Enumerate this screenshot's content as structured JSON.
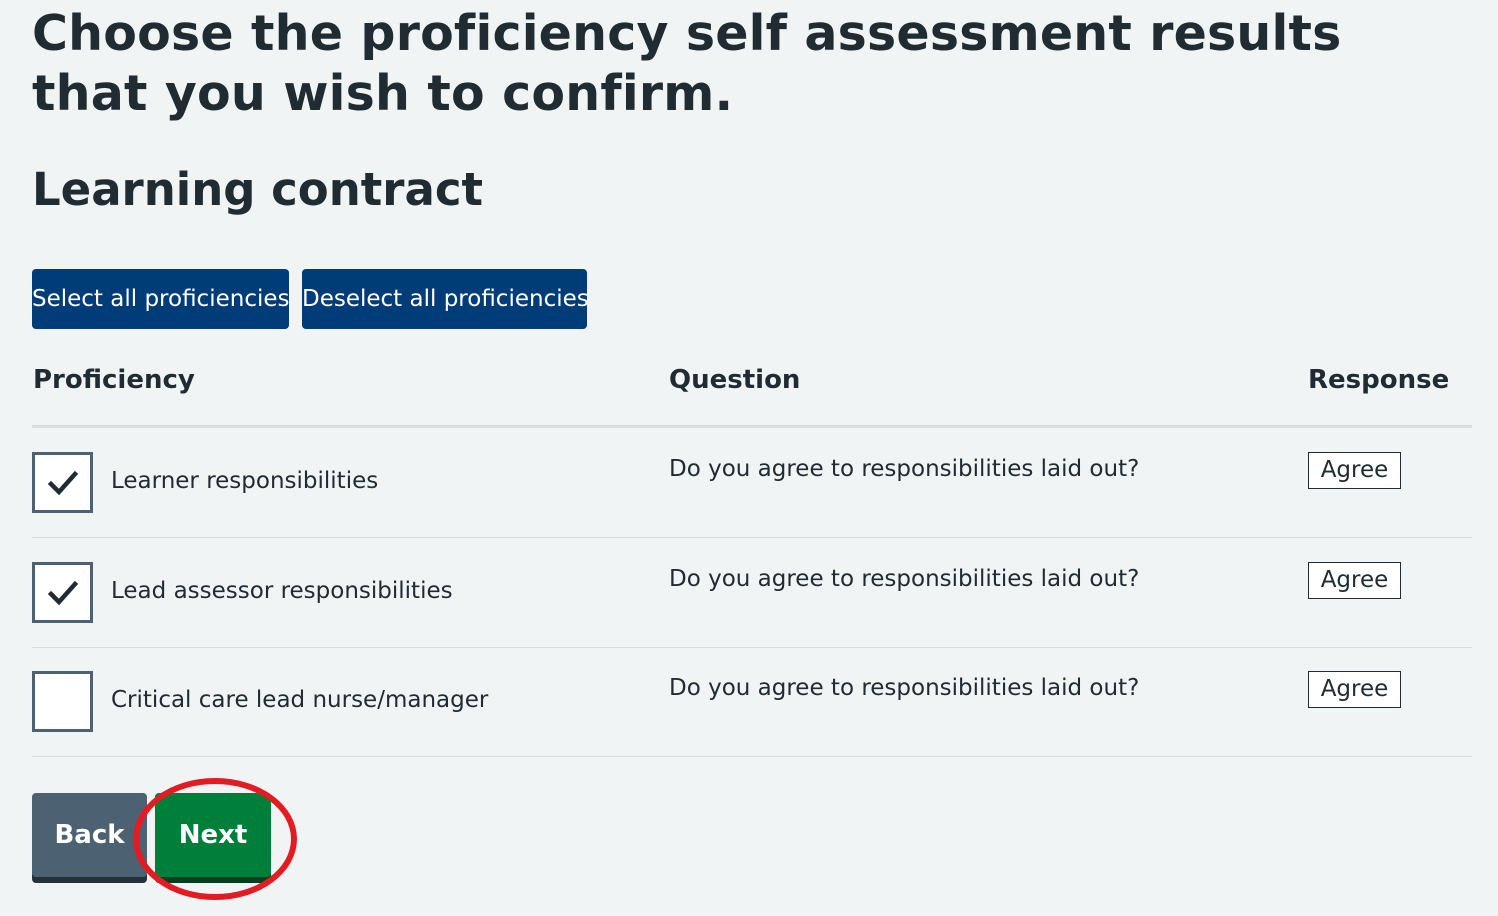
{
  "page": {
    "title": "Choose the proficiency self assessment results that you wish to confirm.",
    "section_title": "Learning contract"
  },
  "bulk_actions": {
    "select_all_label": "Select all proficiencies",
    "deselect_all_label": "Deselect all proficiencies"
  },
  "table": {
    "headers": {
      "proficiency": "Proficiency",
      "question": "Question",
      "response": "Response"
    },
    "rows": [
      {
        "checked": true,
        "proficiency": "Learner responsibilities",
        "question": "Do you agree to responsibilities laid out?",
        "response": "Agree"
      },
      {
        "checked": true,
        "proficiency": "Lead assessor responsibilities",
        "question": "Do you agree to responsibilities laid out?",
        "response": "Agree"
      },
      {
        "checked": false,
        "proficiency": "Critical care lead nurse/manager",
        "question": "Do you agree to responsibilities laid out?",
        "response": "Agree"
      }
    ]
  },
  "navigation": {
    "back_label": "Back",
    "next_label": "Next"
  },
  "colors": {
    "background": "#f0f4f5",
    "primary_blue": "#003d78",
    "next_green": "#007f3b",
    "back_grey": "#4c6272",
    "highlight_red": "#e31c23"
  },
  "icons": {
    "checkmark": "check-icon"
  }
}
